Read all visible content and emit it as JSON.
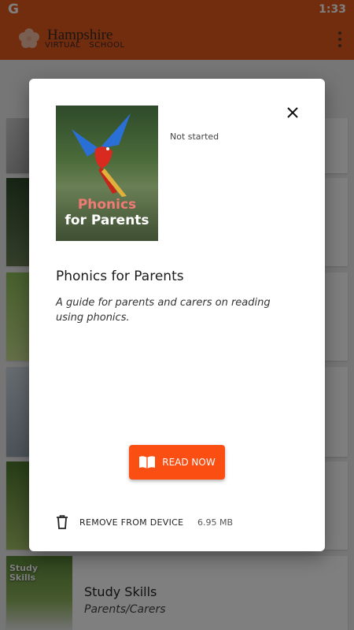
{
  "status_bar": {
    "app_icon": "G",
    "time": "1:33"
  },
  "app_bar": {
    "brand_line1": "Hampshire",
    "brand_line2": "VIRTUAL   SCHOOL",
    "overflow_icon": "more-vert-icon"
  },
  "background_list": {
    "items": [
      {
        "title": "Study Skills",
        "subtitle": "Parents/Carers",
        "thumb_label": "Study\nSkills"
      }
    ]
  },
  "dialog": {
    "cover": {
      "line1": "Phonics",
      "line2": "for Parents"
    },
    "status": "Not started",
    "title": "Phonics for Parents",
    "description": "A guide for parents and carers on reading using phonics.",
    "read_button": {
      "label": "READ NOW",
      "icon": "book-open-icon"
    },
    "remove": {
      "label": "REMOVE FROM DEVICE",
      "icon": "trash-icon",
      "size": "6.95 MB"
    },
    "close_icon": "close-icon"
  },
  "colors": {
    "primary": "#e25a1c",
    "accent_button": "#fa4e12",
    "cover_title_accent": "#f07a74"
  }
}
